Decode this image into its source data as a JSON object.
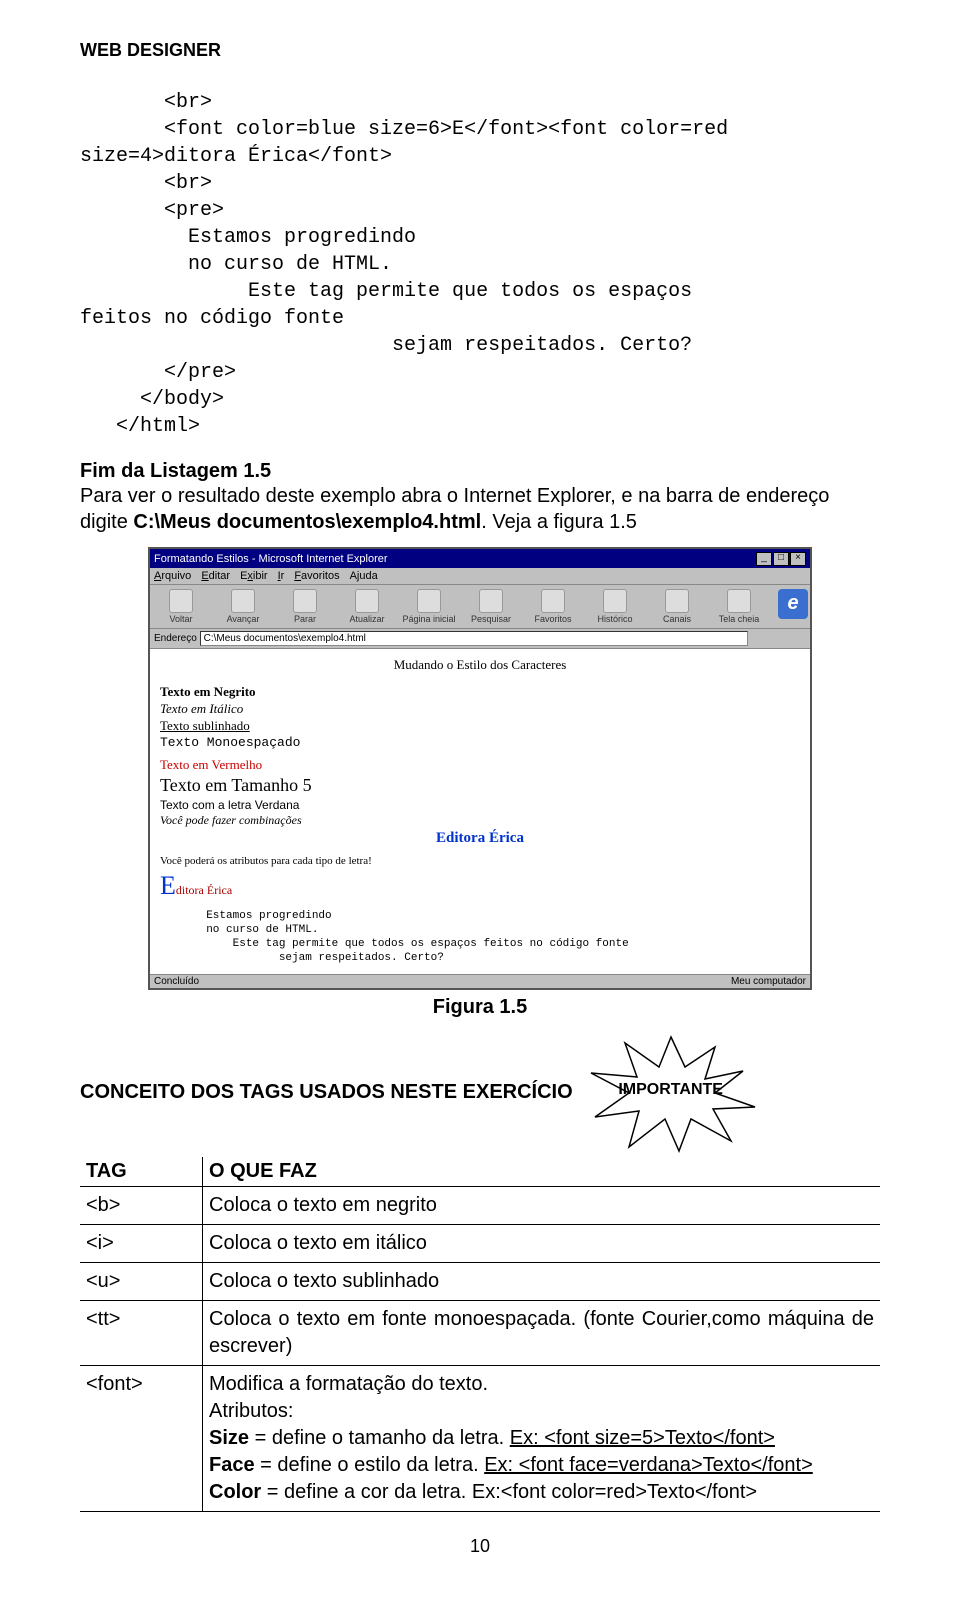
{
  "header": "WEB DESIGNER",
  "code": "       <br>\n       <font color=blue size=6>E</font><font color=red\nsize=4>ditora Érica</font>\n       <br>\n       <pre>\n         Estamos progredindo\n         no curso de HTML.\n              Este tag permite que todos os espaços\nfeitos no código fonte\n                          sejam respeitados. Certo?\n       </pre>\n     </body>\n   </html>",
  "listing_label": "Fim da Listagem 1.5",
  "para": "Para ver o resultado deste exemplo abra o Internet Explorer, e na barra de endereço digite ",
  "para_bold": "C:\\Meus documentos\\exemplo4.html",
  "para_tail": ". Veja a figura 1.5",
  "browser": {
    "title": "Formatando Estilos - Microsoft Internet Explorer",
    "menu": [
      "Arquivo",
      "Editar",
      "Exibir",
      "Ir",
      "Favoritos",
      "Ajuda"
    ],
    "toolbar": [
      "Voltar",
      "Avançar",
      "Parar",
      "Atualizar",
      "Página inicial",
      "Pesquisar",
      "Favoritos",
      "Histórico",
      "Canais",
      "Tela cheia"
    ],
    "addr_label": "Endereço",
    "addr_value": "C:\\Meus documentos\\exemplo4.html",
    "content": {
      "heading": "Mudando o Estilo dos Caracteres",
      "l1": "Texto em Negrito",
      "l2": "Texto em Itálico",
      "l3": "Texto sublinhado",
      "l4": "Texto Monoespaçado",
      "l5": "Texto em Vermelho",
      "l6": "Texto em Tamanho 5",
      "l7": "Texto com a letra Verdana",
      "l8": "Você pode fazer combinações",
      "l9": "Editora Érica",
      "l10": "Você poderá os atributos para cada tipo de letra!",
      "l11a": "E",
      "l11b": "ditora Érica",
      "pre": "       Estamos progredindo\n       no curso de HTML.\n           Este tag permite que todos os espaços feitos no código fonte\n                  sejam respeitados. Certo?"
    },
    "status_left": "Concluído",
    "status_right": "Meu computador"
  },
  "fig_caption": "Figura 1.5",
  "concept_title": "CONCEITO DOS TAGS USADOS NESTE EXERCÍCIO",
  "star_label": "IMPORTANTE",
  "table": {
    "h1": "TAG",
    "h2": "O QUE FAZ",
    "rows": [
      {
        "t": "<b>",
        "d": "Coloca o texto em negrito"
      },
      {
        "t": "<i>",
        "d": "Coloca o texto em itálico"
      },
      {
        "t": "<u>",
        "d": "Coloca o texto sublinhado"
      }
    ],
    "tt_tag": "<tt>",
    "tt_desc": "Coloca o texto em  fonte monoespaçada. (fonte Courier,como máquina de escrever)",
    "font_tag": "<font>",
    "font_l1": "Modifica a formatação do texto.",
    "font_l2": "Atributos:",
    "font_s1a": "Size",
    "font_s1b": " = define o tamanho da letra. ",
    "font_s1c": "Ex: <font size=5>Texto</font>",
    "font_s2a": "Face",
    "font_s2b": " = define o estilo da letra. ",
    "font_s2c": "Ex: <font face=verdana>Texto</font>",
    "font_s3a": "Color",
    "font_s3b": " = define a cor da letra. ",
    "font_s3c": "Ex:<font color=red>Texto</font>"
  },
  "page_number": "10"
}
